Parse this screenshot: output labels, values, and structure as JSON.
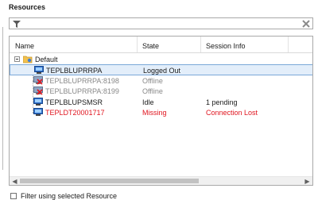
{
  "panel": {
    "title": "Resources"
  },
  "filter": {
    "value": "",
    "placeholder": ""
  },
  "columns": {
    "name": "Name",
    "state": "State",
    "session": "Session Info"
  },
  "group": {
    "label": "Default"
  },
  "rows": [
    {
      "name": "TEPLBLUPRRPA",
      "state": "Logged Out",
      "session": "",
      "status": "selected",
      "icon": "computer-icon"
    },
    {
      "name": "TEPLBLUPRRPA:8198",
      "state": "Offline",
      "session": "",
      "status": "offline",
      "icon": "computer-offline-icon"
    },
    {
      "name": "TEPLBLUPRRPA:8199",
      "state": "Offline",
      "session": "",
      "status": "offline",
      "icon": "computer-offline-icon"
    },
    {
      "name": "TEPLBLUPSMSR",
      "state": "Idle",
      "session": "1 pending",
      "status": "idle",
      "icon": "computer-icon"
    },
    {
      "name": "TEPLDT20001717",
      "state": "Missing",
      "session": "Connection Lost",
      "status": "missing",
      "icon": "computer-missing-icon"
    }
  ],
  "checkbox": {
    "label": "Filter using selected Resource",
    "checked": false
  },
  "colors": {
    "selected_bg": "#e3eefa",
    "selected_border": "#7aa8d8",
    "offline_text": "#888888",
    "missing_text": "#e0141e"
  }
}
